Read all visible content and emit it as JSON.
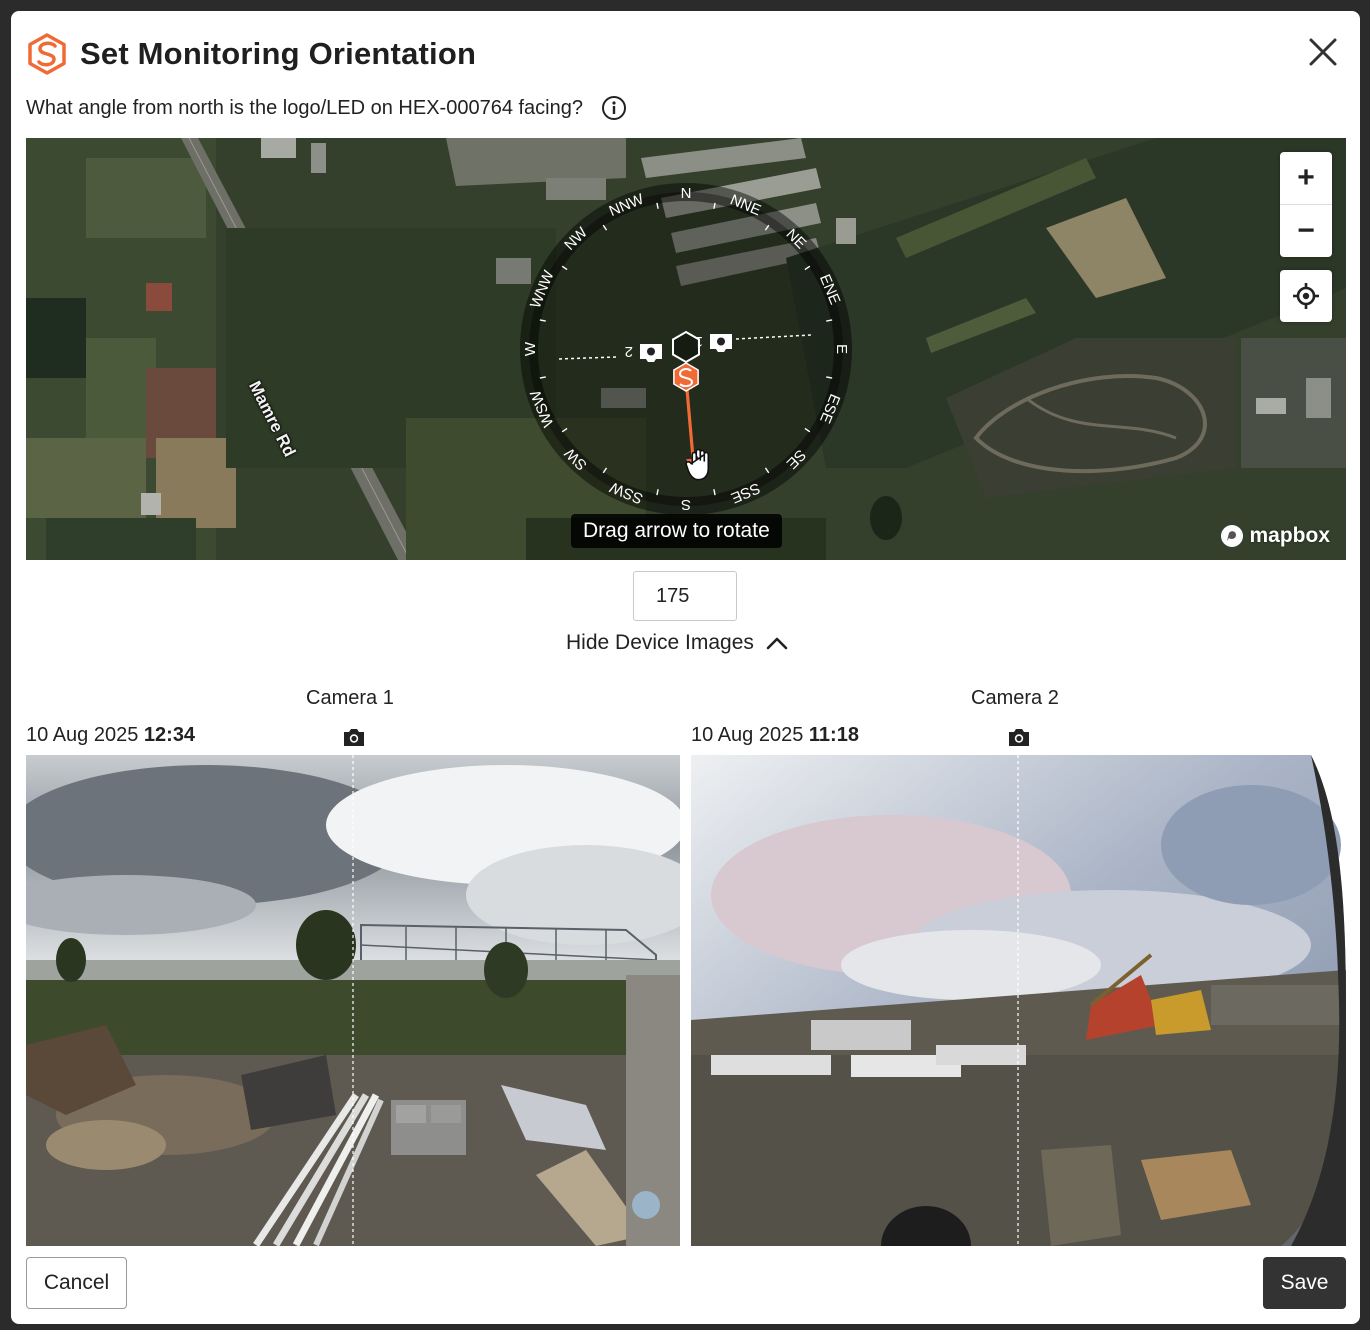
{
  "dialog": {
    "title": "Set Monitoring Orientation",
    "question": "What angle from north is the logo/LED on HEX-000764 facing?"
  },
  "map": {
    "road_label": "Mamre Rd",
    "hint": "Drag arrow to rotate",
    "attribution": "mapbox",
    "zoom_in_label": "+",
    "zoom_out_label": "−",
    "compass": {
      "directions": [
        "N",
        "NNE",
        "NE",
        "ENE",
        "E",
        "ESE",
        "SE",
        "SSE",
        "S",
        "SSW",
        "SW",
        "WSW",
        "W",
        "WNW",
        "NW",
        "NNW"
      ],
      "camera_markers": [
        "1",
        "2"
      ],
      "arrow_angle_deg": 175
    },
    "colors": {
      "arrow": "#f06a35",
      "brand": "#f06a35"
    }
  },
  "angle": {
    "value": "175"
  },
  "device_images": {
    "toggle_label": "Hide Device Images",
    "cameras": [
      {
        "title": "Camera 1",
        "date": "10 Aug 2025",
        "time": "12:34"
      },
      {
        "title": "Camera 2",
        "date": "10 Aug 2025",
        "time": "11:18"
      }
    ]
  },
  "footer": {
    "cancel_label": "Cancel",
    "save_label": "Save"
  }
}
